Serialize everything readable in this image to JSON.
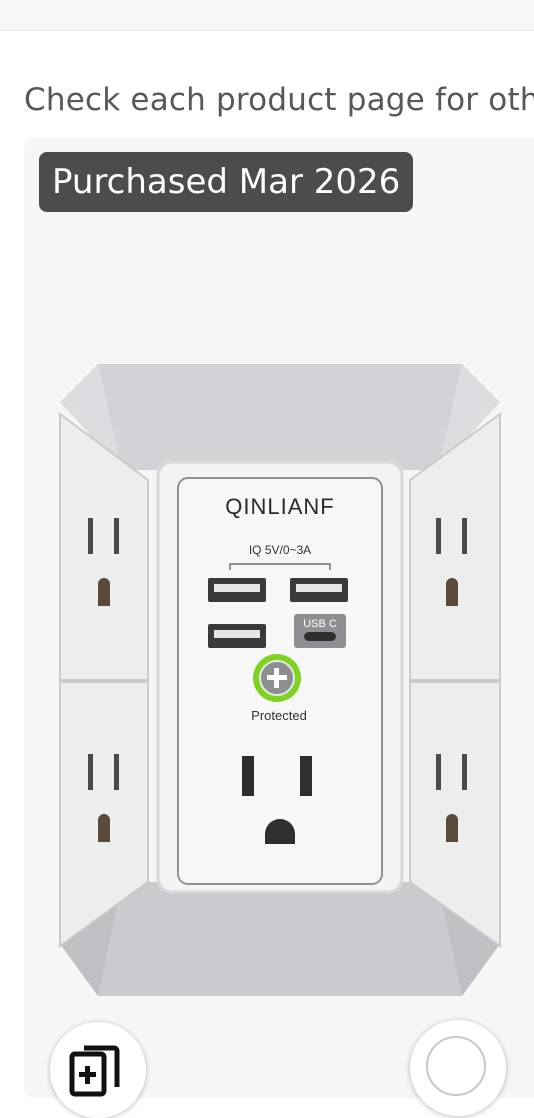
{
  "page": {
    "hint_text": "Check each product page for oth"
  },
  "product": {
    "badge": "Purchased Mar 2026",
    "image": {
      "brand_text": "QINLIANF",
      "usb_spec_text": "IQ 5V/0~3A",
      "usb_c_label": "USB C",
      "protected_label": "Protected"
    }
  },
  "actions": {
    "add_to_list_icon": "add-to-list-icon",
    "select_icon": "select-circle-icon"
  },
  "colors": {
    "badge_bg": "#4c4c4c",
    "card_bg": "#f6f6f6",
    "indicator_green": "#7ed321",
    "hint_text": "#565959"
  }
}
